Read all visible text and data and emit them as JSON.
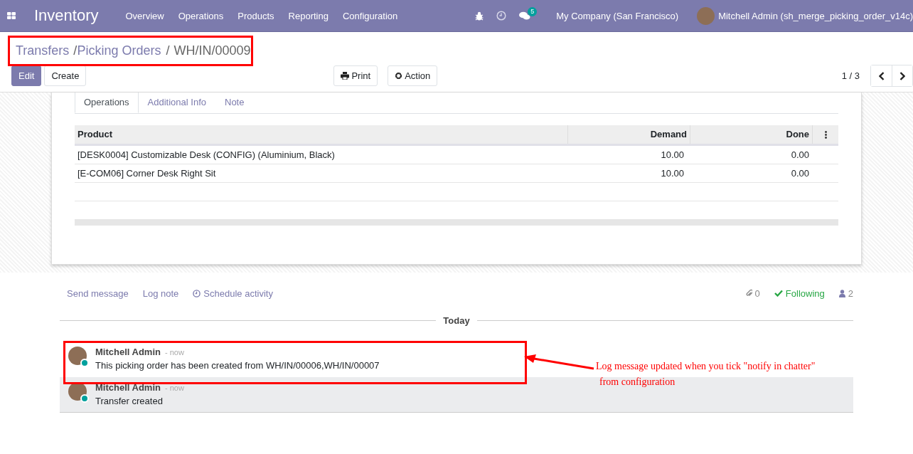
{
  "navbar": {
    "app_name": "Inventory",
    "menu": [
      "Overview",
      "Operations",
      "Products",
      "Reporting",
      "Configuration"
    ],
    "messages_badge": "5",
    "company": "My Company (San Francisco)",
    "user": "Mitchell Admin (sh_merge_picking_order_v14c)"
  },
  "breadcrumb": {
    "items": [
      "Transfers",
      "Picking Orders"
    ],
    "separators": [
      "/",
      "/"
    ],
    "current": "WH/IN/00009"
  },
  "buttons": {
    "edit": "Edit",
    "create": "Create",
    "print": "Print",
    "action": "Action"
  },
  "pager": "1 / 3",
  "tabs": [
    {
      "label": "Operations",
      "selected": true
    },
    {
      "label": "Additional Info",
      "selected": false
    },
    {
      "label": "Note",
      "selected": false
    }
  ],
  "table": {
    "columns": [
      "Product",
      "Demand",
      "Done"
    ],
    "rows": [
      [
        "[DESK0004] Customizable Desk (CONFIG) (Aluminium, Black)",
        "10.00",
        "0.00"
      ],
      [
        "[E-COM06] Corner Desk Right Sit",
        "10.00",
        "0.00"
      ]
    ]
  },
  "chatter": {
    "actions": [
      "Send message",
      "Log note",
      "Schedule activity"
    ],
    "attachments": "0",
    "following": "Following",
    "followers": "2",
    "date_separator": "Today",
    "messages": [
      {
        "author": "Mitchell Admin",
        "time": "- now",
        "body": "This picking order has been created from WH/IN/00006,WH/IN/00007",
        "highlighted": false
      },
      {
        "author": "Mitchell Admin",
        "time": "- now",
        "body": "Transfer created",
        "highlighted": true
      }
    ]
  },
  "annotation": {
    "lines": [
      "Log message updated when you tick \"notify in chatter\"",
      "from configuration"
    ]
  }
}
